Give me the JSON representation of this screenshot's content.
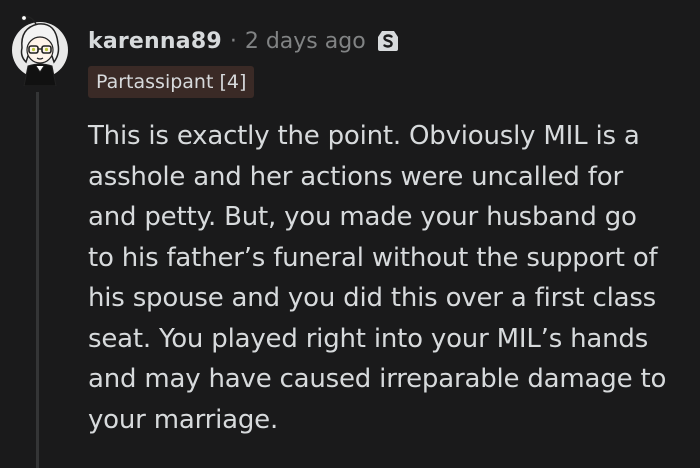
{
  "comment": {
    "author": "karenna89",
    "separator": "·",
    "timestamp": "2 days ago",
    "flair": "Partassipant [4]",
    "award_icon": "silver-award-icon",
    "body_lines": [
      "This is exactly the point. Obviously MIL is a",
      "asshole and her actions were uncalled for",
      "and petty. But, you made your husband go",
      "to his father’s funeral without the support of",
      "his spouse and you did this over a first class",
      "seat. You played right into your MIL’s hands",
      "and may have caused irreparable damage to",
      "your marriage."
    ]
  },
  "colors": {
    "background": "#1a1a1b",
    "text": "#d7dadc",
    "meta": "#818384",
    "flair_bg": "#3a2a26",
    "thread_line": "#343536"
  }
}
